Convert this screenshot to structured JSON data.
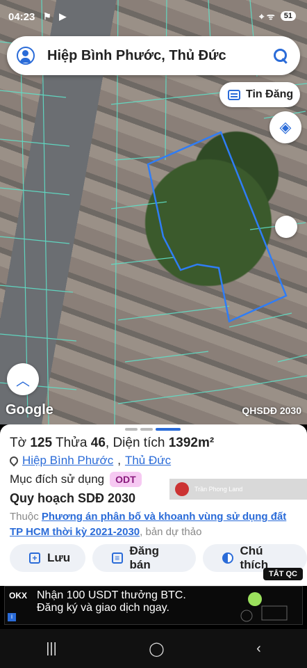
{
  "status_bar": {
    "time": "04:23",
    "left_icons": "⚑ ▶",
    "right_icons": "⌖ ᯤ",
    "battery": "51"
  },
  "search": {
    "query": "Hiệp Bình Phước, Thủ Đức"
  },
  "map": {
    "tin_dang_label": "Tin Đăng",
    "google_label": "Google",
    "layer_label": "QHSDĐ 2030",
    "boundary_color": "#2f7df6",
    "parcel_line_color": "#5fe0c8"
  },
  "parcel": {
    "to_label": "Tờ",
    "to_value": "125",
    "thua_label": "Thửa",
    "thua_value": "46",
    "dien_tich_label": "Diện tích",
    "dien_tich_value": "1392m²",
    "ward": "Hiệp Bình Phước",
    "district": "Thủ Đức",
    "separator": ",",
    "purpose_label": "Mục đích sử dụng",
    "purpose_badge": "ODT",
    "plan_title": "Quy hoạch SDĐ 2030",
    "plan_prefix": "Thuộc",
    "plan_link": "Phương án phân bố và khoanh vùng sử dụng đất TP HCM thời kỳ 2021-2030",
    "plan_suffix": ", bản dự thảo",
    "watermark": "Trần Phong Land"
  },
  "actions": {
    "save": "Lưu",
    "post": "Đăng bán",
    "legend": "Chú thích"
  },
  "ad": {
    "close_label": "TẮT QC",
    "brand": "OKX",
    "line1": "Nhận 100 USDT thưởng BTC.",
    "line2": "Đăng ký và giao dịch ngay."
  },
  "nav": {
    "recents": "|||",
    "home": "◯",
    "back": "‹"
  }
}
